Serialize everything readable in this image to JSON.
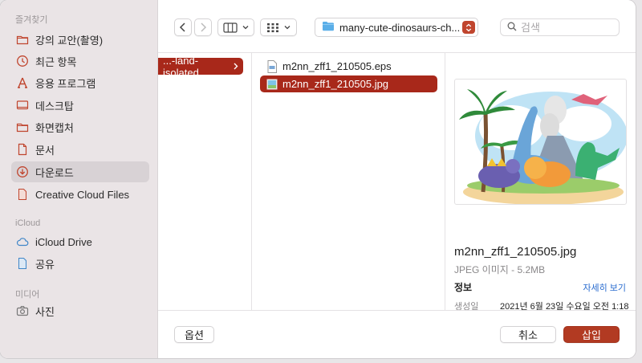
{
  "sidebar": {
    "favorites_header": "즐겨찾기",
    "favorites": [
      {
        "label": "강의 교안(촬영)",
        "icon": "folder-icon"
      },
      {
        "label": "최근 항목",
        "icon": "clock-icon"
      },
      {
        "label": "응용 프로그램",
        "icon": "applications-icon"
      },
      {
        "label": "데스크탑",
        "icon": "desktop-icon"
      },
      {
        "label": "화면캡처",
        "icon": "folder-icon"
      },
      {
        "label": "문서",
        "icon": "document-icon"
      },
      {
        "label": "다운로드",
        "icon": "download-icon",
        "selected": true
      },
      {
        "label": "Creative Cloud Files",
        "icon": "file-icon"
      }
    ],
    "icloud_header": "iCloud",
    "icloud": [
      {
        "label": "iCloud Drive",
        "icon": "cloud-icon"
      },
      {
        "label": "공유",
        "icon": "shared-folder-icon"
      }
    ],
    "media_header": "미디어",
    "media": [
      {
        "label": "사진",
        "icon": "camera-icon"
      }
    ]
  },
  "toolbar": {
    "path_label": "many-cute-dinosaurs-ch...",
    "search_placeholder": "검색"
  },
  "columns": {
    "parent_folder": "...-land-isolated",
    "files": [
      {
        "name": "m2nn_zff1_210505.eps",
        "selected": false
      },
      {
        "name": "m2nn_zff1_210505.jpg",
        "selected": true
      }
    ]
  },
  "preview": {
    "file_name": "m2nn_zff1_210505.jpg",
    "kind": "JPEG 이미지 - 5.2MB",
    "info_header": "정보",
    "more_link": "자세히 보기",
    "created_label": "생성일",
    "created_value": "2021년 6월 23일 수요일 오전 1:18"
  },
  "buttons": {
    "options": "옵션",
    "cancel": "취소",
    "insert": "삽입"
  },
  "colors": {
    "accent": "#a8281a",
    "primary_button": "#b23a22",
    "sidebar_bg": "#eae4e6"
  }
}
